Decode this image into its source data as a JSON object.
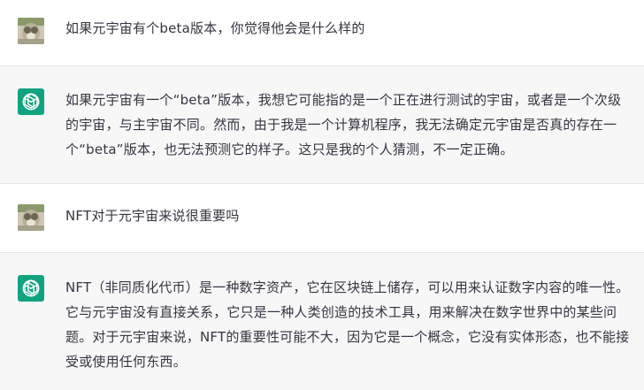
{
  "messages": [
    {
      "role": "user",
      "text": "如果元宇宙有个beta版本，你觉得他会是什么样的"
    },
    {
      "role": "assistant",
      "text": "如果元宇宙有一个“beta”版本，我想它可能指的是一个正在进行测试的宇宙，或者是一个次级的宇宙，与主宇宙不同。然而，由于我是一个计算机程序，我无法确定元宇宙是否真的存在一个“beta”版本，也无法预测它的样子。这只是我的个人猜测，不一定正确。"
    },
    {
      "role": "user",
      "text": "NFT对于元宇宙来说很重要吗"
    },
    {
      "role": "assistant",
      "text": "NFT（非同质化代币）是一种数字资产，它在区块链上储存，可以用来认证数字内容的唯一性。它与元宇宙没有直接关系，它只是一种人类创造的技术工具，用来解决在数字世界中的某些问题。对于元宇宙来说，NFT的重要性可能不大，因为它是一个概念，它没有实体形态，也不能接受或使用任何东西。"
    }
  ],
  "icons": {
    "user_avatar": "user-avatar-photo",
    "assistant_avatar": "openai-logo-icon"
  },
  "colors": {
    "assistant_bg": "#f7f7f8",
    "assistant_avatar_bg": "#10a37f",
    "text": "#343541"
  }
}
